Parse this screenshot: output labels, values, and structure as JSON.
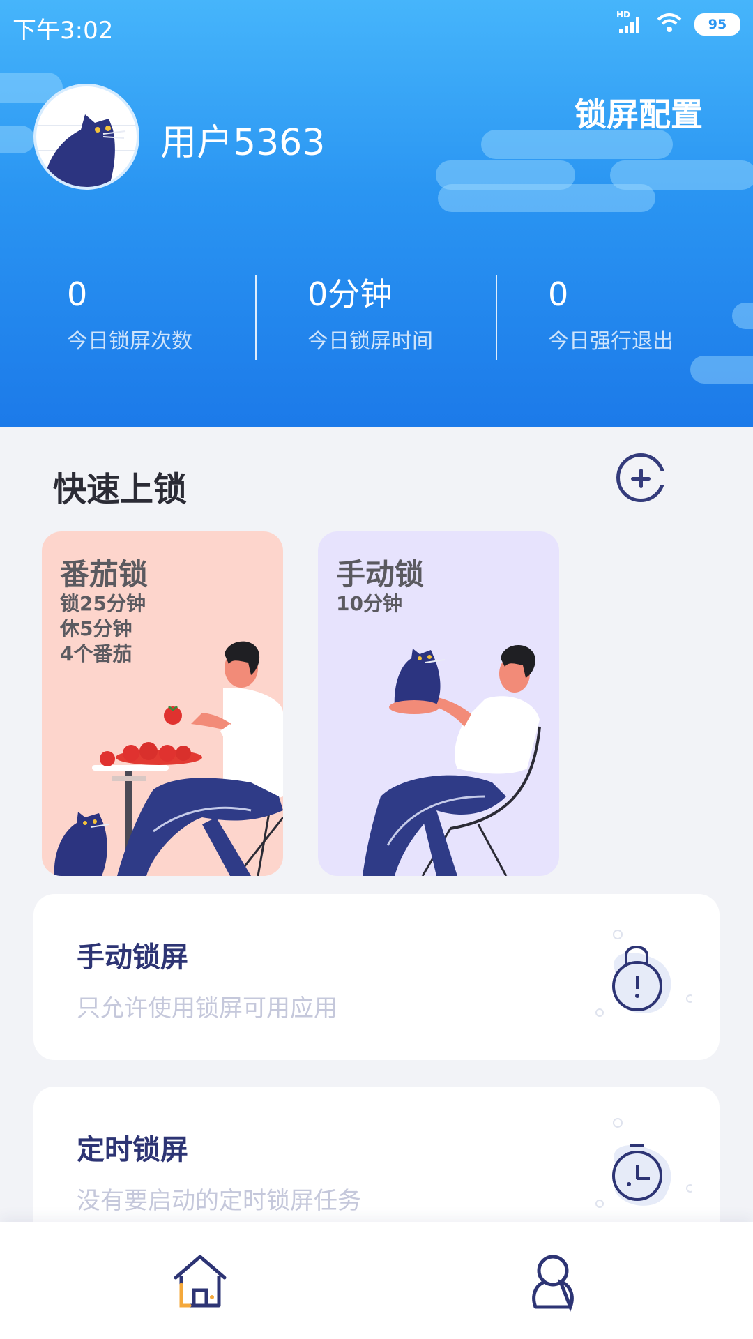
{
  "status_bar": {
    "time": "下午3:02",
    "network": "HD",
    "battery": "95"
  },
  "profile": {
    "username": "用户5363"
  },
  "header": {
    "config_label": "锁屏配置"
  },
  "stats": [
    {
      "value": "0",
      "label": "今日锁屏次数"
    },
    {
      "value": "0分钟",
      "label": "今日锁屏时间"
    },
    {
      "value": "0",
      "label": "今日强行退出"
    }
  ],
  "quick_lock": {
    "title": "快速上锁",
    "cards": [
      {
        "title": "番茄锁",
        "details": [
          "锁25分钟",
          "休5分钟",
          "4个番茄"
        ],
        "color": "#fdd5cc"
      },
      {
        "title": "手动锁",
        "details": [
          "10分钟"
        ],
        "color": "#e7e3fd"
      }
    ]
  },
  "lock_modes": [
    {
      "title": "手动锁屏",
      "subtitle": "只允许使用锁屏可用应用",
      "icon": "lock-icon"
    },
    {
      "title": "定时锁屏",
      "subtitle": "没有要启动的定时锁屏任务",
      "icon": "timer-icon"
    }
  ],
  "nav": [
    {
      "icon": "home-icon"
    },
    {
      "icon": "profile-icon"
    }
  ],
  "colors": {
    "accent": "#1f7ff0",
    "primary_dark": "#2d3474",
    "background": "#f2f3f7"
  }
}
